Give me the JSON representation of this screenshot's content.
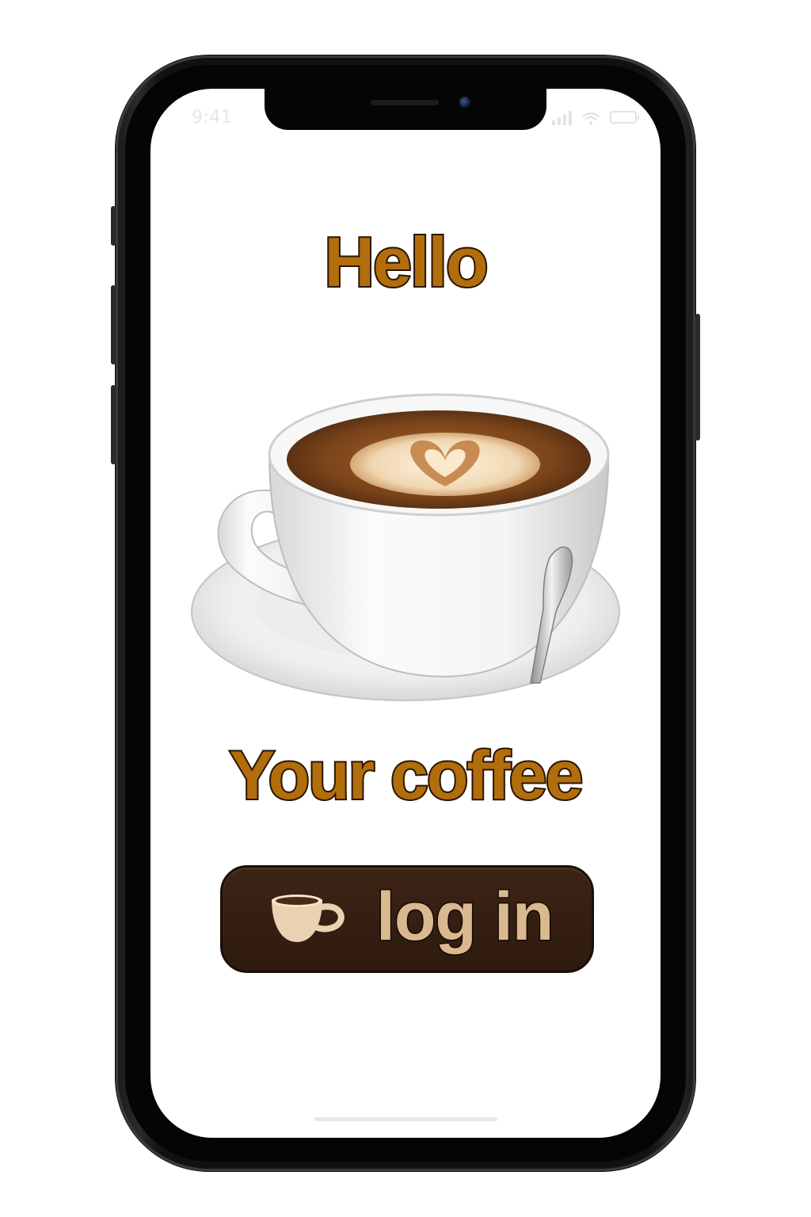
{
  "status_bar": {
    "time": "9:41"
  },
  "main": {
    "title": "Hello",
    "subtitle": "Your coffee",
    "hero_image_icon": "latte-art-cup-illustration"
  },
  "login_button": {
    "label": "log in",
    "icon": "coffee-cup-icon"
  },
  "colors": {
    "title_fill": "#b26d0c",
    "title_outline": "#2a1503",
    "button_bg": "#3d2416",
    "button_text": "#d9b98d",
    "phone_frame": "#111111"
  }
}
